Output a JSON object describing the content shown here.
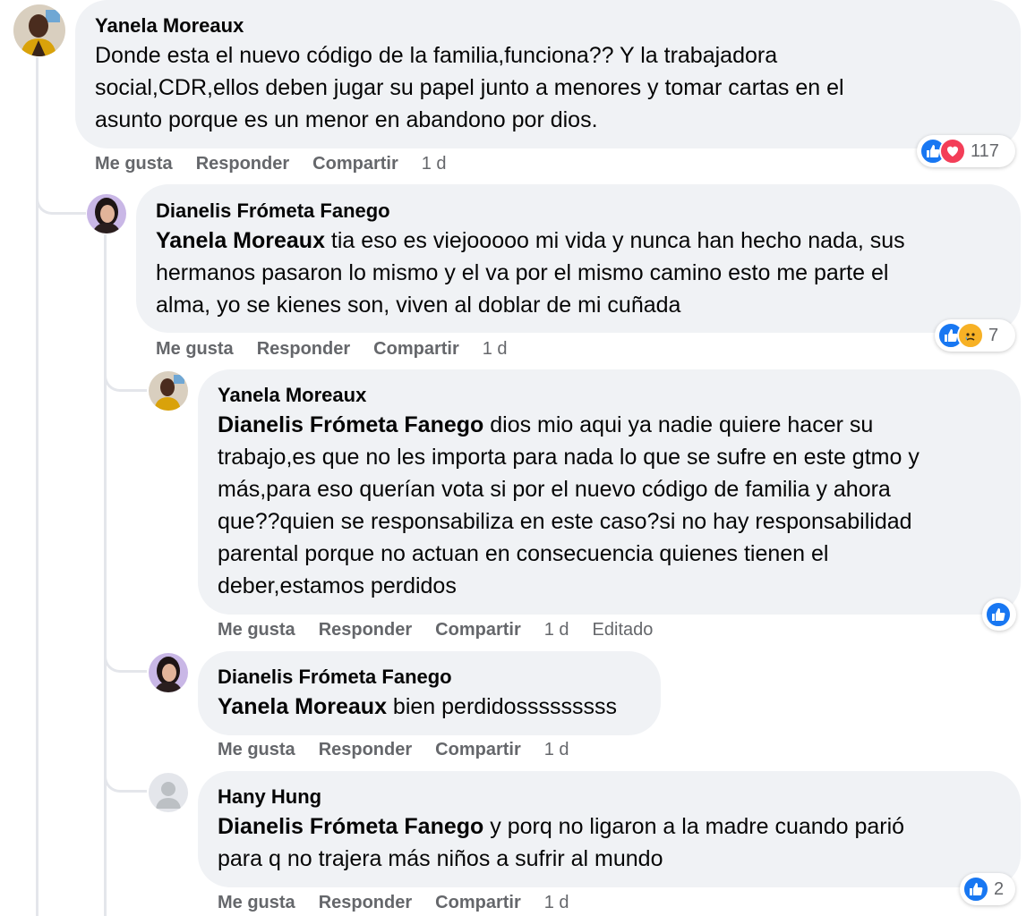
{
  "comments": [
    {
      "author": "Yanela Moreaux",
      "mention": "",
      "text": "Donde esta el nuevo código de la familia,funciona?? Y la trabajadora\nsocial,CDR,ellos deben jugar su papel junto a menores y tomar cartas en el\nasunto porque es un menor en abandono por dios.",
      "actions": {
        "like": "Me gusta",
        "reply": "Responder",
        "share": "Compartir",
        "time": "1 d"
      },
      "reactions": {
        "icons": [
          "like-icon",
          "love-icon"
        ],
        "count": "117"
      }
    },
    {
      "author": "Dianelis Frómeta Fanego",
      "mention": "Yanela Moreaux",
      "text": " tia eso es viejooooo mi vida y nunca han hecho nada, sus\nhermanos pasaron lo mismo y el va por el mismo camino esto me parte el\nalma, yo se kienes son, viven al doblar de mi cuñada",
      "actions": {
        "like": "Me gusta",
        "reply": "Responder",
        "share": "Compartir",
        "time": "1 d"
      },
      "reactions": {
        "icons": [
          "like-icon",
          "sad-icon"
        ],
        "count": "7"
      }
    },
    {
      "author": "Yanela Moreaux",
      "mention": "Dianelis Frómeta Fanego",
      "text": " dios mio aqui ya nadie quiere hacer su\ntrabajo,es que no les importa para nada lo que se sufre en este gtmo y\nmás,para eso querían vota si por el nuevo código de familia y ahora\nque??quien se responsabiliza en este caso?si no hay responsabilidad\nparental porque no actuan en consecuencia quienes tienen el\ndeber,estamos perdidos",
      "actions": {
        "like": "Me gusta",
        "reply": "Responder",
        "share": "Compartir",
        "time": "1 d",
        "edited": "Editado"
      },
      "reactions": {
        "icons": [
          "like-icon"
        ],
        "count": ""
      }
    },
    {
      "author": "Dianelis Frómeta Fanego",
      "mention": "Yanela Moreaux",
      "text": " bien perdidosssssssss",
      "actions": {
        "like": "Me gusta",
        "reply": "Responder",
        "share": "Compartir",
        "time": "1 d"
      },
      "reactions": null
    },
    {
      "author": "Hany Hung",
      "mention": "Dianelis Frómeta Fanego",
      "text": " y porq no ligaron a la madre cuando parió\npara q no trajera más niños a sufrir al mundo",
      "actions": {
        "like": "Me gusta",
        "reply": "Responder",
        "share": "Compartir",
        "time": "1 d"
      },
      "reactions": {
        "icons": [
          "like-icon"
        ],
        "count": "2"
      }
    }
  ],
  "colors": {
    "bubble": "#f0f2f5",
    "like": "#1877f2",
    "love": "#f33e58",
    "sad": "#f7b125",
    "muted": "#65676b"
  }
}
